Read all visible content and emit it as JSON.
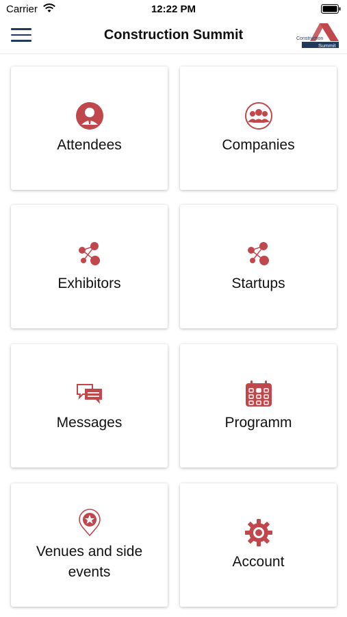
{
  "status_bar": {
    "carrier": "Carrier",
    "time": "12:22 PM"
  },
  "nav": {
    "title": "Construction Summit",
    "logo_line1": "Construction",
    "logo_line2": "Summit"
  },
  "tiles": [
    {
      "label": "Attendees",
      "icon": "person-icon"
    },
    {
      "label": "Companies",
      "icon": "group-icon"
    },
    {
      "label": "Exhibitors",
      "icon": "network-icon"
    },
    {
      "label": "Startups",
      "icon": "network-icon"
    },
    {
      "label": "Messages",
      "icon": "chat-icon"
    },
    {
      "label": "Programm",
      "icon": "calendar-icon"
    },
    {
      "label": "Venues and side events",
      "icon": "star-pin-icon"
    },
    {
      "label": "Account",
      "icon": "gear-icon"
    }
  ],
  "colors": {
    "accent": "#c0474b",
    "navy": "#1f3a5c"
  }
}
